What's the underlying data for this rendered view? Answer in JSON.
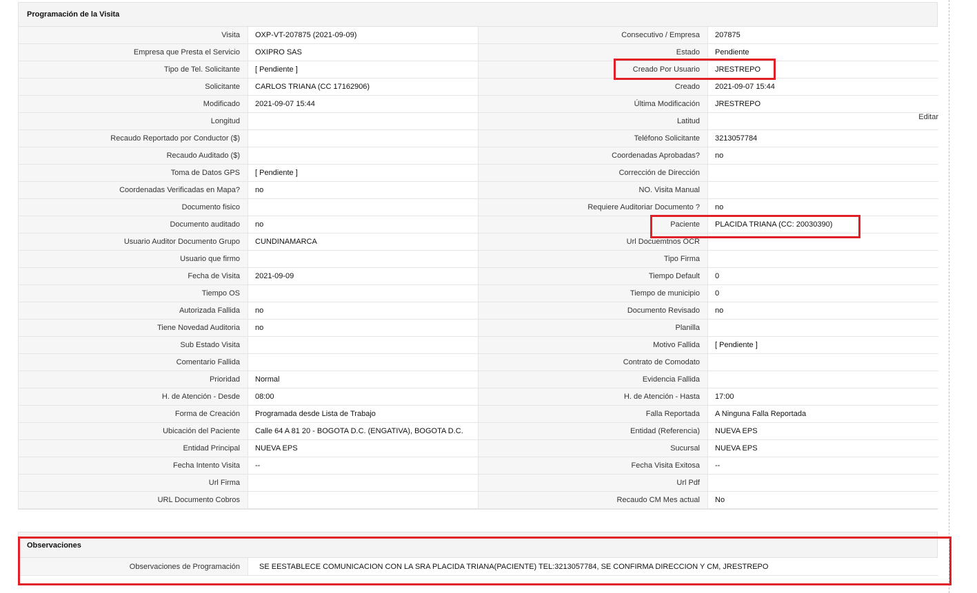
{
  "section1": {
    "title": "Programación de la Visita",
    "edit_label": "Editar"
  },
  "rows": [
    {
      "l1": "Visita",
      "v1": "OXP-VT-207875 (2021-09-09)",
      "l2": "Consecutivo / Empresa",
      "v2": "207875"
    },
    {
      "l1": "Empresa que Presta el Servicio",
      "v1": "OXIPRO SAS",
      "l2": "Estado",
      "v2": "Pendiente"
    },
    {
      "l1": "Tipo de Tel. Solicitante",
      "v1": "[ Pendiente ]",
      "l2": "Creado Por Usuario",
      "v2": "JRESTREPO"
    },
    {
      "l1": "Solicitante",
      "v1": "CARLOS TRIANA (CC 17162906)",
      "l2": "Creado",
      "v2": "2021-09-07 15:44"
    },
    {
      "l1": "Modificado",
      "v1": "2021-09-07 15:44",
      "l2": "Última Modificación",
      "v2": " JRESTREPO"
    },
    {
      "l1": "Longitud",
      "v1": "",
      "l2": "Latitud",
      "v2": ""
    },
    {
      "l1": "Recaudo Reportado por Conductor ($)",
      "v1": "",
      "l2": "Teléfono Solicitante",
      "v2": "3213057784"
    },
    {
      "l1": "Recaudo Auditado ($)",
      "v1": "",
      "l2": "Coordenadas Aprobadas?",
      "v2": " no"
    },
    {
      "l1": "Toma de Datos GPS",
      "v1": "[ Pendiente ]",
      "l2": "Corrección de Dirección",
      "v2": ""
    },
    {
      "l1": "Coordenadas Verificadas en Mapa?",
      "v1": " no",
      "l2": "NO. Visita Manual",
      "v2": ""
    },
    {
      "l1": "Documento fisico",
      "v1": "",
      "l2": "Requiere Auditoriar Documento ?",
      "v2": " no"
    },
    {
      "l1": "Documento auditado",
      "v1": " no",
      "l2": "Paciente",
      "v2": "PLACIDA TRIANA (CC: 20030390)"
    },
    {
      "l1": "Usuario Auditor Documento Grupo",
      "v1": "CUNDINAMARCA",
      "l2": "Url Docuemtnos OCR",
      "v2": ""
    },
    {
      "l1": "Usuario que firmo",
      "v1": "",
      "l2": "Tipo Firma",
      "v2": ""
    },
    {
      "l1": "Fecha de Visita",
      "v1": " 2021-09-09",
      "l2": "Tiempo Default",
      "v2": "0"
    },
    {
      "l1": "Tiempo OS",
      "v1": "",
      "l2": "Tiempo de municipio",
      "v2": "0"
    },
    {
      "l1": "Autorizada Fallida",
      "v1": " no",
      "l2": "Documento Revisado",
      "v2": " no"
    },
    {
      "l1": "Tiene Novedad Auditoria",
      "v1": " no",
      "l2": "Planilla",
      "v2": ""
    },
    {
      "l1": "Sub Estado Visita",
      "v1": "",
      "l2": "Motivo Fallida",
      "v2": "[ Pendiente ]"
    },
    {
      "l1": "Comentario Fallida",
      "v1": "",
      "l2": "Contrato de Comodato",
      "v2": ""
    },
    {
      "l1": "Prioridad",
      "v1": "Normal",
      "l2": "Evidencia Fallida",
      "v2": ""
    },
    {
      "l1": "H. de Atención - Desde",
      "v1": "08:00",
      "l2": "H. de Atención - Hasta",
      "v2": "17:00"
    },
    {
      "l1": "Forma de Creación",
      "v1": "Programada desde Lista de Trabajo",
      "l2": "Falla Reportada",
      "v2": "A Ninguna Falla Reportada"
    },
    {
      "l1": "Ubicación del Paciente",
      "v1": "Calle 64 A 81 20 - BOGOTA D.C. (ENGATIVA), BOGOTA D.C.",
      "l2": "Entidad (Referencia)",
      "v2": "NUEVA EPS"
    },
    {
      "l1": "Entidad Principal",
      "v1": "NUEVA EPS",
      "l2": "Sucursal",
      "v2": "NUEVA EPS"
    },
    {
      "l1": "Fecha Intento Visita",
      "v1": "--",
      "l2": "Fecha Visita Exitosa",
      "v2": "--"
    },
    {
      "l1": "Url Firma",
      "v1": "",
      "l2": "Url Pdf",
      "v2": ""
    },
    {
      "l1": "URL Documento Cobros",
      "v1": "",
      "l2": "Recaudo CM Mes actual",
      "v2": "No"
    }
  ],
  "observaciones": {
    "title": "Observaciones",
    "label": "Observaciones de Programación",
    "value": "SE EESTABLECE COMUNICACION CON LA SRA PLACIDA TRIANA(PACIENTE) TEL:3213057784, SE CONFIRMA DIRECCION Y CM, JRESTREPO"
  },
  "colors": {
    "highlight": "#e01f26",
    "label_bg": "#f6f6f6",
    "header_bg": "#f4f4f4"
  }
}
